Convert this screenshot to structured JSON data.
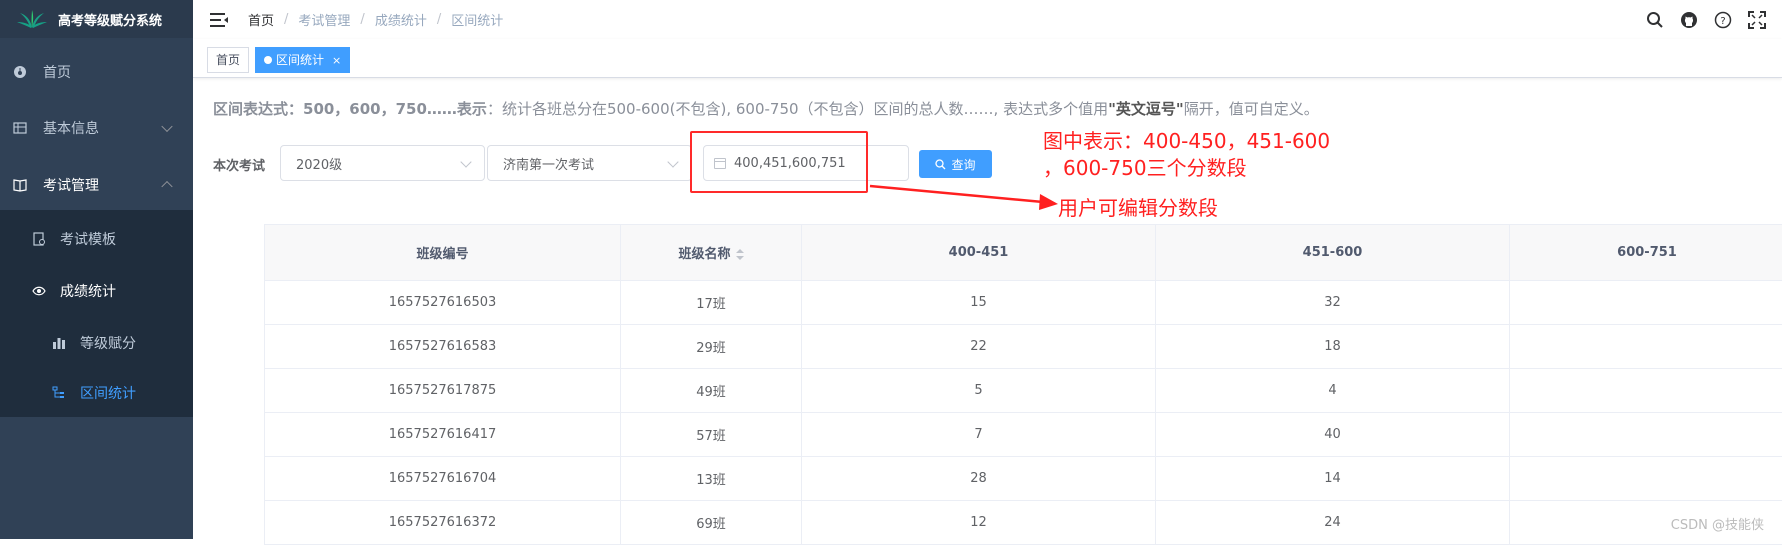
{
  "sidebar": {
    "title": "高考等级赋分系统",
    "items": [
      {
        "label": "首页",
        "icon": "dashboard-icon"
      },
      {
        "label": "基本信息",
        "icon": "grid-icon"
      },
      {
        "label": "考试管理",
        "icon": "book-icon"
      }
    ],
    "sub_items": [
      {
        "label": "考试模板",
        "icon": "document-icon"
      },
      {
        "label": "成绩统计",
        "icon": "eye-icon"
      }
    ],
    "sub_sub_items": [
      {
        "label": "等级赋分",
        "icon": "bar-chart-icon"
      },
      {
        "label": "区间统计",
        "icon": "tree-icon"
      }
    ]
  },
  "breadcrumb": [
    "首页",
    "考试管理",
    "成绩统计",
    "区间统计"
  ],
  "tags": {
    "home": "首页",
    "active": "区间统计",
    "close": "×"
  },
  "hint": {
    "bold": "区间表达式：500，600，750……表示",
    "text": "：统计各班总分在500-600(不包含), 600-750（不包含）区间的总人数……, 表达式多个值用",
    "quote": "\"英文逗号\"",
    "tail": "隔开，值可自定义。"
  },
  "form": {
    "label": "本次考试",
    "grade": "2020级",
    "exam": "济南第一次考试",
    "range_value": "400,451,600,751",
    "query": "查询"
  },
  "annotations": {
    "line1": "图中表示：400-450，451-600",
    "line2": "，600-750三个分数段",
    "line3": "用户可编辑分数段"
  },
  "table": {
    "headers": [
      "班级编号",
      "班级名称",
      "400-451",
      "451-600",
      "600-751"
    ],
    "rows": [
      [
        "1657527616503",
        "17班",
        "15",
        "32",
        ""
      ],
      [
        "1657527616583",
        "29班",
        "22",
        "18",
        ""
      ],
      [
        "1657527617875",
        "49班",
        "5",
        "4",
        ""
      ],
      [
        "1657527616417",
        "57班",
        "7",
        "40",
        ""
      ],
      [
        "1657527616704",
        "13班",
        "28",
        "14",
        ""
      ],
      [
        "1657527616372",
        "69班",
        "12",
        "24",
        ""
      ]
    ]
  },
  "watermark": "CSDN @技能侠",
  "colors": {
    "sidebar_bg": "#304156",
    "submenu_bg": "#1f2d3d",
    "accent": "#409eff",
    "annotation": "#ff2020"
  }
}
